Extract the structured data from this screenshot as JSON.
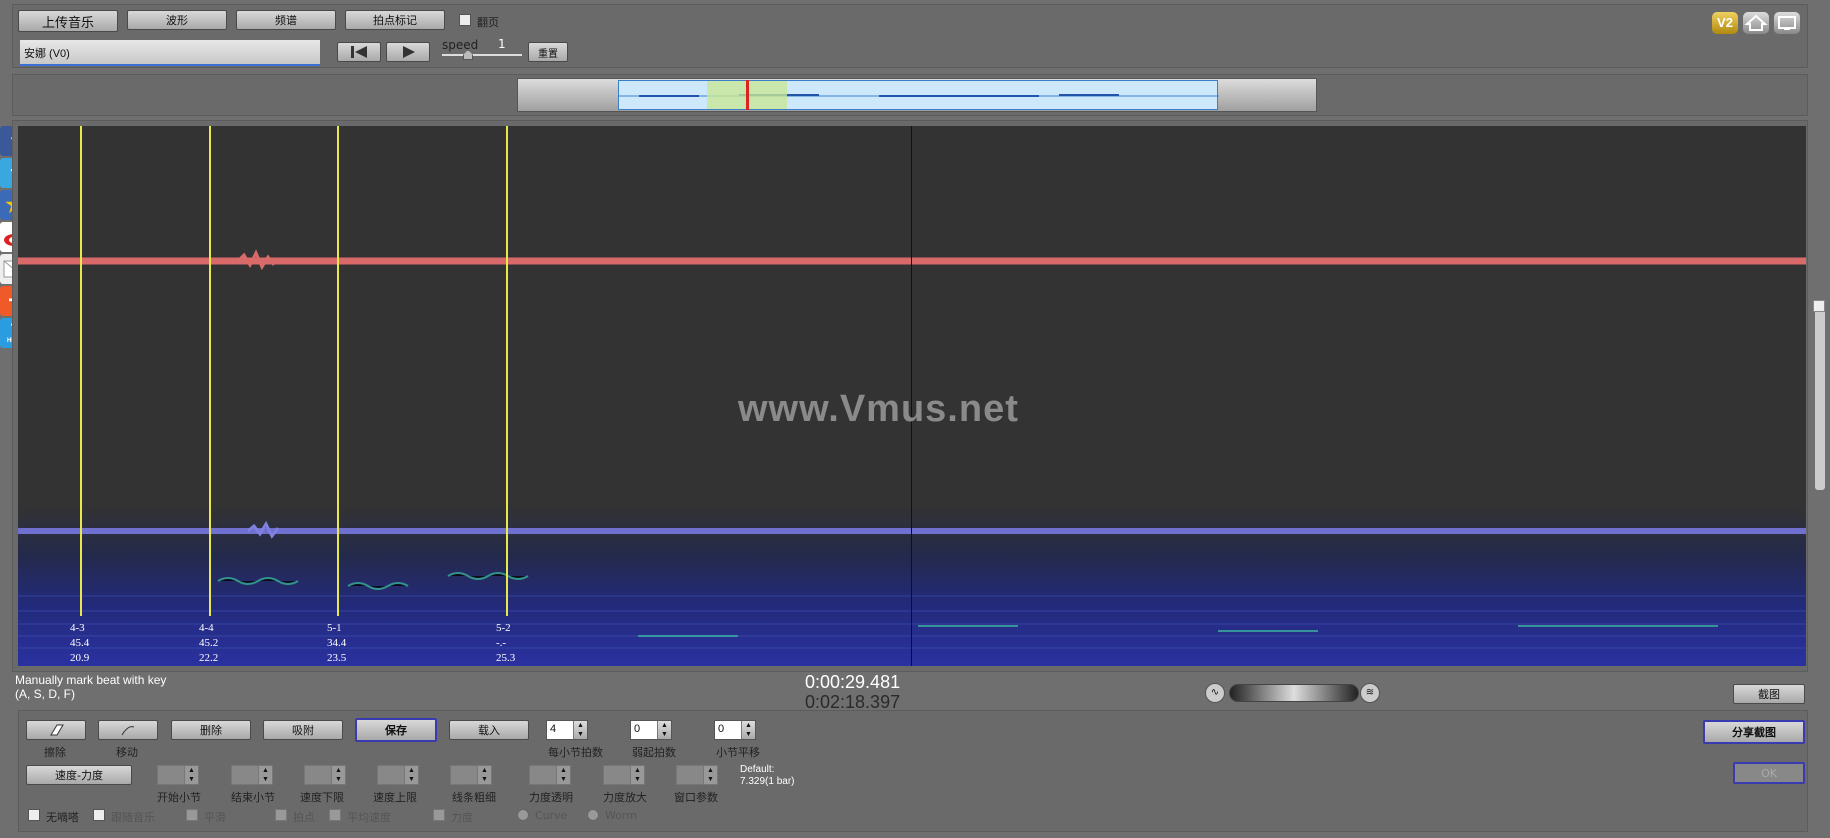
{
  "toolbar": {
    "upload_label": "上传音乐",
    "waveform_label": "波形",
    "spectrum_label": "频谱",
    "beat_mark_label": "拍点标记",
    "page_turn_label": "翻页",
    "song_name": "安娜 (V0)",
    "speed_label": "speed",
    "speed_value": "1",
    "reset_label": "重置"
  },
  "top_right_icons": [
    "v2-icon",
    "home-icon",
    "monitor-icon"
  ],
  "social_icons": [
    "facebook-icon",
    "twitter-icon",
    "favorite-icon",
    "weibo-icon",
    "email-icon",
    "share-plus-icon",
    "help-icon"
  ],
  "help_icon_text": "HELP",
  "v2_text": "V2",
  "watermark": "www.Vmus.net",
  "beats": [
    {
      "bar": "4-3",
      "tempo": "45.4",
      "dyn": "20.9"
    },
    {
      "bar": "4-4",
      "tempo": "45.2",
      "dyn": "22.2"
    },
    {
      "bar": "5-1",
      "tempo": "34.4",
      "dyn": "23.5"
    },
    {
      "bar": "5-2",
      "tempo": "-.-",
      "dyn": "25.3"
    }
  ],
  "hint": {
    "line1": "Manually mark beat with key",
    "line2": "(A, S, D, F)"
  },
  "time": {
    "current": "0:00:29.481",
    "total": "0:02:18.397"
  },
  "screenshot_label": "截图",
  "edit": {
    "erase_label": "擦除",
    "move_label": "移动",
    "delete_label": "删除",
    "snap_label": "吸附",
    "save_label": "保存",
    "load_label": "载入",
    "beats_per_bar_value": "4",
    "beats_per_bar_label": "每小节拍数",
    "weak_start_value": "0",
    "weak_start_label": "弱起拍数",
    "bar_offset_value": "0",
    "bar_offset_label": "小节平移",
    "share_label": "分享截图"
  },
  "tempo": {
    "mode_label": "速度-力度",
    "start_bar_label": "开始小节",
    "end_bar_label": "结束小节",
    "tempo_min_label": "速度下限",
    "tempo_max_label": "速度上限",
    "line_width_label": "线条粗细",
    "dyn_transparency_label": "力度透明",
    "dyn_zoom_label": "力度放大",
    "window_param_label": "窗口参数",
    "default_line1": "Default:",
    "default_line2": "7.329(1 bar)",
    "ok_label": "OK"
  },
  "options": {
    "no_drag_label": "无嘀嗒",
    "follow_music_label": "跟随音乐",
    "smooth_label": "平滑",
    "beat_point_label": "拍点",
    "avg_speed_label": "平均速度",
    "dynamics_label": "力度",
    "curve_label": "Curve",
    "worm_label": "Worm"
  }
}
